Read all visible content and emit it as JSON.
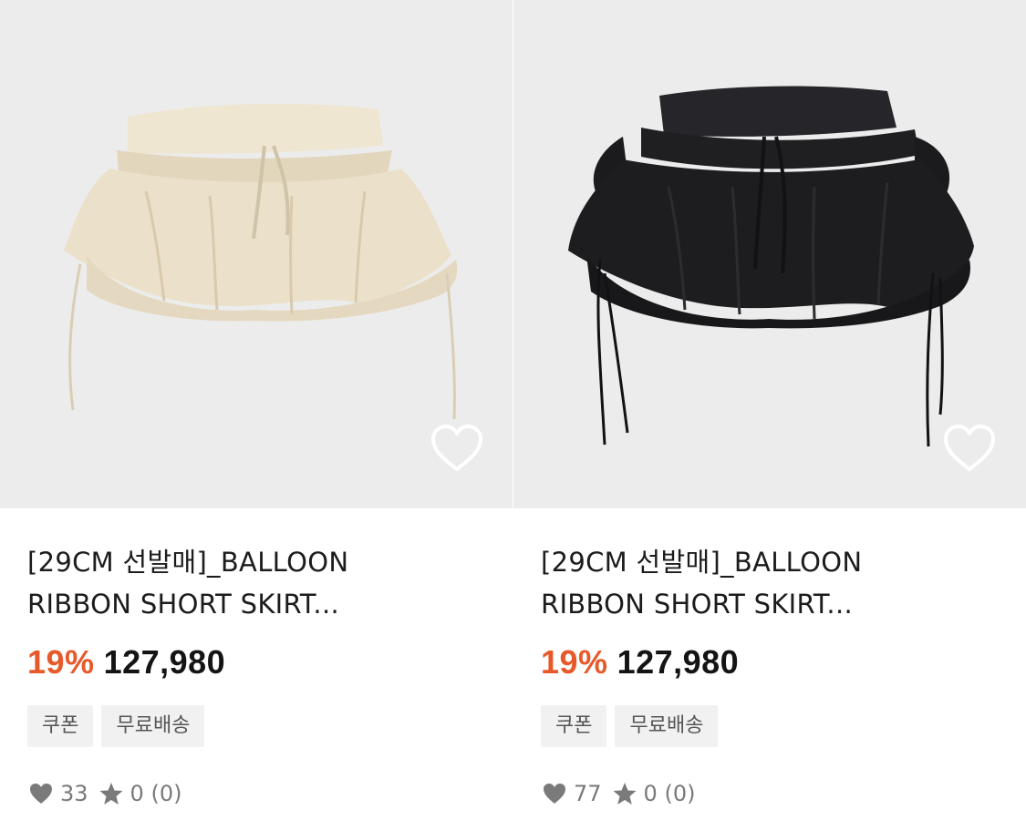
{
  "products": [
    {
      "title_line1": "[29CM 선발매]_BALLOON",
      "title_line2": "RIBBON SHORT SKIRT...",
      "discount": "19%",
      "price": "127,980",
      "tags": [
        "쿠폰",
        "무료배송"
      ],
      "likes": "33",
      "rating": "0",
      "reviews": "(0)",
      "image_color": "#e9dfc9"
    },
    {
      "title_line1": "[29CM 선발매]_BALLOON",
      "title_line2": "RIBBON SHORT SKIRT...",
      "discount": "19%",
      "price": "127,980",
      "tags": [
        "쿠폰",
        "무료배송"
      ],
      "likes": "77",
      "rating": "0",
      "reviews": "(0)",
      "image_color": "#1c1c1e"
    }
  ],
  "colors": {
    "discount": "#e8592a",
    "image_bg": "#ececec",
    "tag_bg": "#f1f1f1",
    "meta_text": "#7a7a7a"
  },
  "icons": {
    "wishlist": "heart-outline-icon",
    "likes": "heart-icon",
    "rating": "star-icon"
  }
}
